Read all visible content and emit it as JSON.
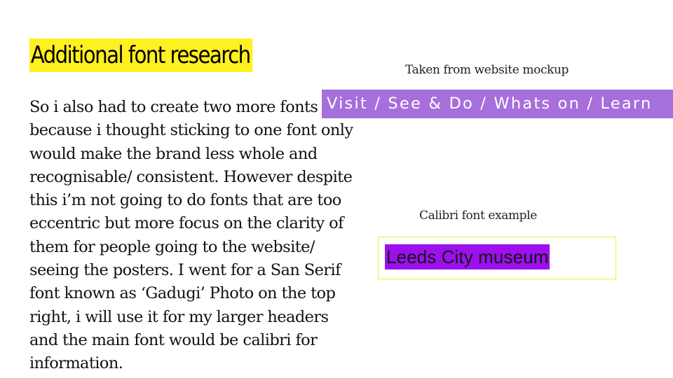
{
  "slide": {
    "title": "Additional font research",
    "body_lines": [
      "So i also had to create two more fonts",
      "because i thought sticking to one font only",
      "would make the brand less whole and",
      "recognisable/ consistent. However despite",
      "this i’m not going to do fonts that are too",
      "eccentric but more focus on the clarity of",
      "them for people going to the website/",
      "seeing the posters. I went for a San Serif",
      "font known as ‘Gadugi’ Photo on the top",
      "right, i will use it for my larger headers",
      "and the main font would be calibri for",
      "information."
    ],
    "mockup_caption": "Taken from website mockup",
    "nav_example": "Visit / See & Do / Whats on / Learn",
    "calibri_caption": "Calibri font example",
    "calibri_example": "Leeds City museum"
  },
  "colors": {
    "title_highlight": "#fff01f",
    "nav_background": "#a66fdc",
    "example_highlight": "#9b10ec",
    "example_border": "#f3ec3a"
  }
}
